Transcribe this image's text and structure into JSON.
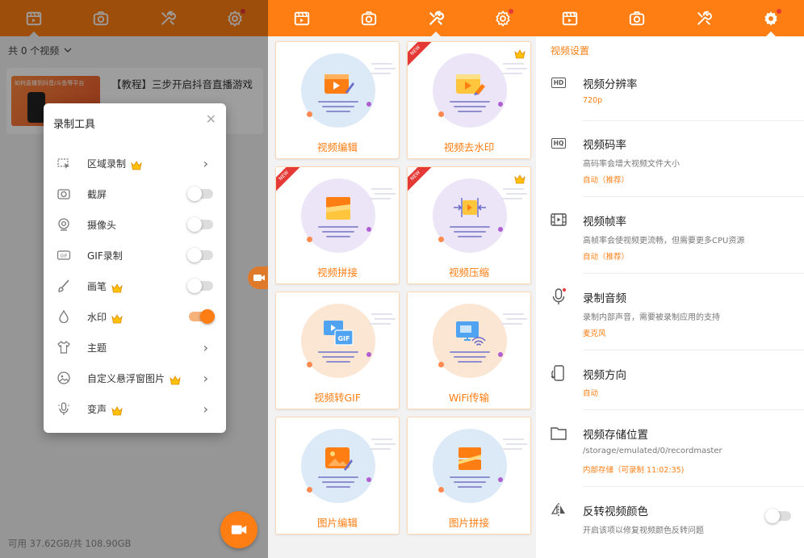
{
  "colors": {
    "accent": "#ff7e13",
    "badge_red": "#e53935",
    "crown_gold": "#ffc107"
  },
  "topbar_icons": [
    "video-list-icon",
    "camera-icon",
    "tools-icon",
    "settings-icon"
  ],
  "screen1": {
    "video_count": "共 0 个视频",
    "video_item": {
      "thumb_text": "如何直播到抖音/斗鱼等平台",
      "title": "【教程】三步开启抖音直播游戏"
    },
    "storage": "可用 37.62GB/共 108.90GB",
    "dialog": {
      "title": "录制工具",
      "items": [
        {
          "label": "区域录制",
          "icon": "region-record-icon",
          "premium": true,
          "control": "arrow"
        },
        {
          "label": "截屏",
          "icon": "screenshot-icon",
          "premium": false,
          "control": "toggle",
          "on": false
        },
        {
          "label": "摄像头",
          "icon": "webcam-icon",
          "premium": false,
          "control": "toggle",
          "on": false
        },
        {
          "label": "GIF录制",
          "icon": "gif-icon",
          "premium": false,
          "control": "toggle",
          "on": false
        },
        {
          "label": "画笔",
          "icon": "brush-icon",
          "premium": true,
          "control": "toggle",
          "on": false
        },
        {
          "label": "水印",
          "icon": "watermark-drop-icon",
          "premium": true,
          "control": "toggle",
          "on": true
        },
        {
          "label": "主题",
          "icon": "tshirt-icon",
          "premium": false,
          "control": "arrow"
        },
        {
          "label": "自定义悬浮窗图片",
          "icon": "custom-image-icon",
          "premium": true,
          "control": "arrow"
        },
        {
          "label": "变声",
          "icon": "voice-changer-icon",
          "premium": true,
          "control": "arrow"
        }
      ]
    }
  },
  "screen2": {
    "cards": [
      {
        "label": "视频编辑",
        "icon": "video-edit-icon",
        "circle": "#dce9f7",
        "new": false,
        "premium": false
      },
      {
        "label": "视频去水印",
        "icon": "remove-watermark-icon",
        "circle": "#ece4f7",
        "new": true,
        "premium": true
      },
      {
        "label": "视频拼接",
        "icon": "video-merge-icon",
        "circle": "#ece4f7",
        "new": true,
        "premium": false
      },
      {
        "label": "视频压缩",
        "icon": "video-compress-icon",
        "circle": "#ece4f7",
        "new": true,
        "premium": true
      },
      {
        "label": "视频转GIF",
        "icon": "video-to-gif-icon",
        "circle": "#fbe6d4",
        "new": false,
        "premium": false
      },
      {
        "label": "WiFi传输",
        "icon": "wifi-transfer-icon",
        "circle": "#fbe6d4",
        "new": false,
        "premium": false
      },
      {
        "label": "图片编辑",
        "icon": "image-edit-icon",
        "circle": "#dce9f7",
        "new": false,
        "premium": false
      },
      {
        "label": "图片拼接",
        "icon": "image-stitch-icon",
        "circle": "#dce9f7",
        "new": false,
        "premium": false
      }
    ],
    "new_badge": "NEW"
  },
  "screen3": {
    "section": "视频设置",
    "settings": [
      {
        "title": "视频分辨率",
        "desc": "",
        "value": "720p",
        "icon": "hd-icon",
        "hd_text": "HD"
      },
      {
        "title": "视频码率",
        "desc": "高码率会增大视频文件大小",
        "value": "自动（推荐）",
        "icon": "hq-icon",
        "hd_text": "HQ"
      },
      {
        "title": "视频帧率",
        "desc": "高帧率会使视频更流畅，但需要更多CPU资源",
        "value": "自动（推荐）",
        "icon": "framerate-icon"
      },
      {
        "title": "录制音频",
        "desc": "录制内部声音，需要被录制应用的支持",
        "value": "麦克风",
        "icon": "microphone-icon"
      },
      {
        "title": "视频方向",
        "desc": "",
        "value": "自动",
        "icon": "orientation-icon"
      },
      {
        "title": "视频存储位置",
        "desc": "/storage/emulated/0/recordmaster",
        "value": "内部存储（可录制 11:02:35)",
        "icon": "folder-icon"
      },
      {
        "title": "反转视频颜色",
        "desc": "开启该项以修复视频颜色反转问题",
        "value": "",
        "icon": "invert-color-icon",
        "toggle": false
      }
    ]
  }
}
